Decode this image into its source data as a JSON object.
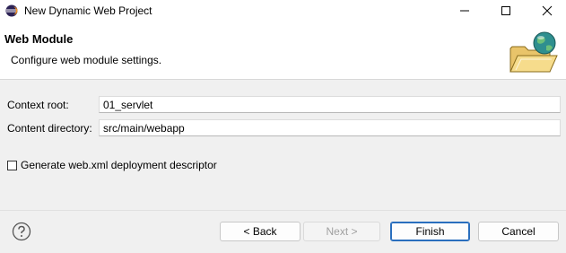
{
  "window": {
    "title": "New Dynamic Web Project",
    "app_icon": "eclipse-icon",
    "controls": [
      "minimize-icon",
      "maximize-icon",
      "close-icon"
    ]
  },
  "header": {
    "title": "Web Module",
    "description": "Configure web module settings.",
    "graphic": "web-module-wizard-icon"
  },
  "form": {
    "context_root_label": "Context root:",
    "context_root_value": "01_servlet",
    "content_dir_label": "Content directory:",
    "content_dir_value": "src/main/webapp",
    "generate_xml_label": "Generate web.xml deployment descriptor",
    "generate_xml_checked": false
  },
  "buttons": {
    "help_icon": "help-icon",
    "back": "< Back",
    "next": "Next >",
    "finish": "Finish",
    "cancel": "Cancel"
  },
  "colors": {
    "accent": "#2a6fbe",
    "background": "#f0f0f0",
    "header_background": "#ffffff"
  }
}
